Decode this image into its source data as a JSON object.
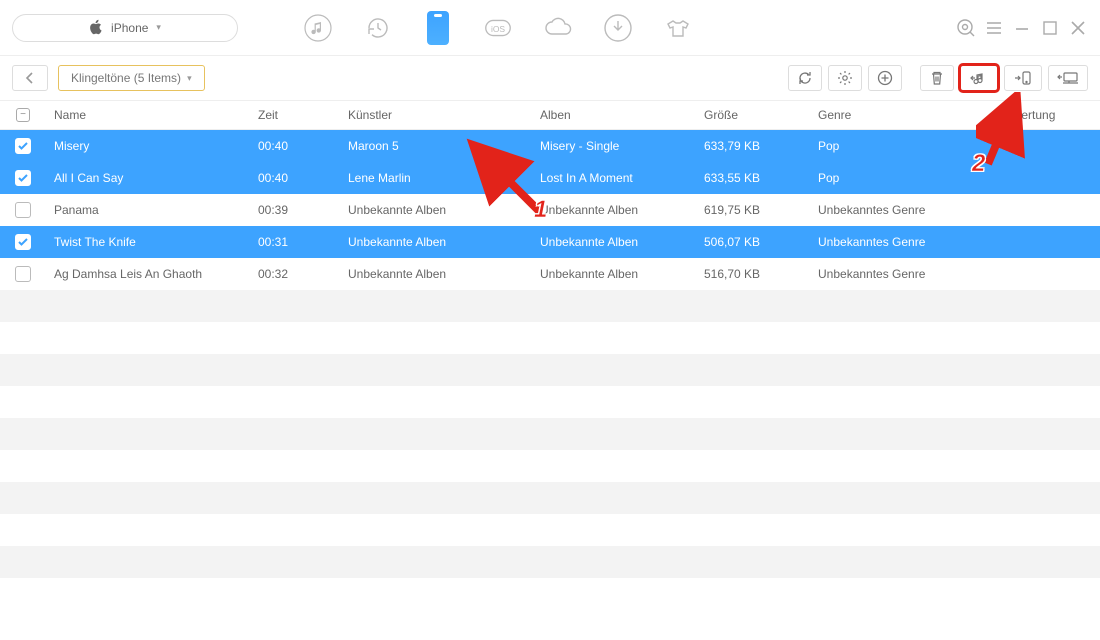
{
  "device": {
    "label": "iPhone"
  },
  "breadcrumb": {
    "label": "Klingeltöne (5 Items)"
  },
  "columns": {
    "name": "Name",
    "time": "Zeit",
    "artist": "Künstler",
    "album": "Alben",
    "size": "Größe",
    "genre": "Genre",
    "rating": "Bewertung"
  },
  "rows": [
    {
      "selected": true,
      "name": "Misery",
      "time": "00:40",
      "artist": "Maroon 5",
      "album": "Misery - Single",
      "size": "633,79 KB",
      "genre": "Pop"
    },
    {
      "selected": true,
      "name": "All I Can Say",
      "time": "00:40",
      "artist": "Lene Marlin",
      "album": "Lost In A Moment",
      "size": "633,55 KB",
      "genre": "Pop"
    },
    {
      "selected": false,
      "name": "Panama",
      "time": "00:39",
      "artist": "Unbekannte Alben",
      "album": "Unbekannte Alben",
      "size": "619,75 KB",
      "genre": "Unbekanntes Genre"
    },
    {
      "selected": true,
      "name": "Twist The Knife",
      "time": "00:31",
      "artist": "Unbekannte Alben",
      "album": "Unbekannte Alben",
      "size": "506,07 KB",
      "genre": "Unbekanntes Genre"
    },
    {
      "selected": false,
      "name": "Ag Damhsa Leis An Ghaoth",
      "time": "00:32",
      "artist": "Unbekannte Alben",
      "album": "Unbekannte Alben",
      "size": "516,70 KB",
      "genre": "Unbekanntes Genre"
    }
  ],
  "annotations": {
    "label1": "1",
    "label2": "2"
  },
  "icons": {
    "apple": "apple-icon",
    "music": "music-icon",
    "history": "history-icon",
    "phone": "phone-icon",
    "ios": "ios-icon",
    "cloud": "cloud-icon",
    "download": "download-icon",
    "shirt": "shirt-icon",
    "search": "search-icon",
    "menu": "menu-icon",
    "minimize": "minimize-icon",
    "maximize": "maximize-icon",
    "close": "close-icon",
    "refresh": "refresh-icon",
    "gear": "gear-icon",
    "add": "add-icon",
    "trash": "trash-icon",
    "to-itunes": "to-itunes-icon",
    "to-device": "to-device-icon",
    "to-computer": "to-computer-icon"
  }
}
